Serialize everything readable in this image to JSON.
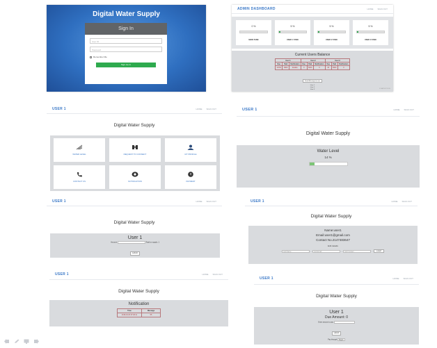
{
  "login": {
    "heading": "Digital Water Supply",
    "form_title": "Sign In",
    "user_placeholder": "User ID",
    "password_placeholder": "Password",
    "remember_label": "Remember Me",
    "signin_button": "Sign me in"
  },
  "admin": {
    "brand": "ADMIN DASHBOARD",
    "nav": [
      "HOME",
      "SIGN OUT"
    ],
    "tanks": [
      {
        "percent": "0 %",
        "level": 0.0,
        "label": "MAIN TANK"
      },
      {
        "percent": "5 %",
        "level": 0.05,
        "label": "USER 1 TANK"
      },
      {
        "percent": "5 %",
        "level": 0.05,
        "label": "USER 2 TANK"
      },
      {
        "percent": "5 %",
        "level": 0.05,
        "label": "USER 3 TANK"
      }
    ],
    "balance_title": "Current Users Balance",
    "balance_users": [
      "User 1",
      "User 2",
      "User 3"
    ],
    "balance_cols": [
      "Due",
      "Paid",
      "Notification"
    ],
    "balance_rows": [
      [
        "11700",
        "9900",
        "Enable",
        "0",
        "5000",
        "0",
        "40",
        "5000",
        "0"
      ]
    ],
    "send_label": "Send Message to user",
    "send_options": [
      "User 1",
      "User 2",
      "User 3"
    ],
    "footer": "5 WATER TECH"
  },
  "user_menu": {
    "brand": "USER 1",
    "nav": [
      "HOME",
      "SIGN OUT"
    ],
    "heading": "Digital Water Supply",
    "tiles": [
      {
        "icon": "water-level-icon",
        "label": "WATER LEVEL"
      },
      {
        "icon": "request-to-connect-icon",
        "label": "REQUEST TO CONNECT"
      },
      {
        "icon": "my-profile-icon",
        "label": "MY PROFILE"
      },
      {
        "icon": "phone-icon",
        "label": "CONTACT US"
      },
      {
        "icon": "notification-icon",
        "label": "NOTIFICATION"
      },
      {
        "icon": "rupee-icon",
        "label": "PAYMENT"
      }
    ]
  },
  "water_level": {
    "brand": "USER 1",
    "nav": [
      "HOME",
      "SIGN OUT"
    ],
    "heading": "Digital Water Supply",
    "panel_title": "Water Level",
    "percent": "14 %",
    "level": 0.14
  },
  "request": {
    "brand": "USER 1",
    "nav": [
      "HOME",
      "SIGN OUT"
    ],
    "heading": "Digital Water Supply",
    "panel_title": "User 1",
    "field_label": "Amount",
    "field_hint": "Total to supply: 1",
    "submit": "submit"
  },
  "profile": {
    "brand": "USER 1",
    "nav": [
      "HOME",
      "SIGN OUT"
    ],
    "heading": "Digital Water Supply",
    "name": "Name:user1",
    "email": "Email:user1@gmail.com",
    "contact": "Contact No.2147483647",
    "edit_label": "Edit details",
    "placeholders": [
      "Edit Name",
      "Edit Email",
      "Edit Contact"
    ],
    "submit": "SUBMIT"
  },
  "notification": {
    "brand": "USER 1",
    "nav": [
      "HOME",
      "SIGN OUT"
    ],
    "heading": "Digital Water Supply",
    "panel_title": "Notification",
    "cols": [
      "Time",
      "Message"
    ],
    "rows": [
      [
        "2018-04-03 07:48:11",
        "55"
      ]
    ]
  },
  "payment": {
    "brand": "USER 1",
    "nav": [
      "HOME",
      "SIGN OUT"
    ],
    "heading": "Digital Water Supply",
    "panel_title": "User 1",
    "due": "Due Amount: 0",
    "enter_label": "Enter amount to pay",
    "submit": "submit",
    "pay_through": "Pay through",
    "pay_method": "Paytm"
  },
  "slide_controls": [
    "prev-icon",
    "pen-icon",
    "screen-icon",
    "next-icon"
  ],
  "colors": {
    "accent": "#3a78c7",
    "green": "#2eaa4e",
    "panel": "#d9dbde",
    "login_bg": "#2f6fc0"
  }
}
